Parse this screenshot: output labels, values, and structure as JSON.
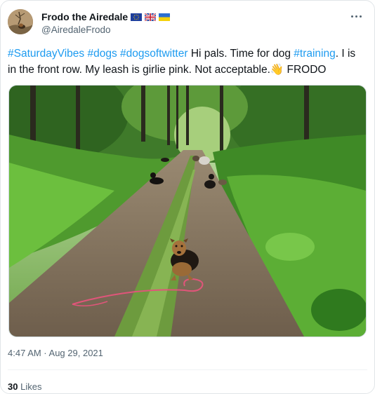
{
  "author": {
    "display_name": "Frodo the Airedale",
    "handle": "@AiredaleFrodo",
    "flags": [
      "eu-flag-icon",
      "uk-flag-icon",
      "ukraine-flag-icon"
    ]
  },
  "tweet": {
    "segments": [
      {
        "type": "hashtag",
        "text": "#SaturdayVibes"
      },
      {
        "type": "text",
        "text": " "
      },
      {
        "type": "hashtag",
        "text": "#dogs"
      },
      {
        "type": "text",
        "text": " "
      },
      {
        "type": "hashtag",
        "text": "#dogsoftwitter"
      },
      {
        "type": "text",
        "text": " Hi pals. Time for dog "
      },
      {
        "type": "hashtag",
        "text": "#training"
      },
      {
        "type": "text",
        "text": ". I is in the front row. My leash is girlie pink. Not acceptable."
      },
      {
        "type": "emoji",
        "text": "👋"
      },
      {
        "type": "text",
        "text": " FRODO"
      }
    ],
    "image_alt": "Dogs lying on a forest dirt road during training"
  },
  "meta": {
    "timestamp": "4:47 AM · Aug 29, 2021",
    "likes_count": "30",
    "likes_label": "Likes"
  },
  "colors": {
    "link": "#1d9bf0",
    "secondary_text": "#536471",
    "primary_text": "#0f1419"
  }
}
